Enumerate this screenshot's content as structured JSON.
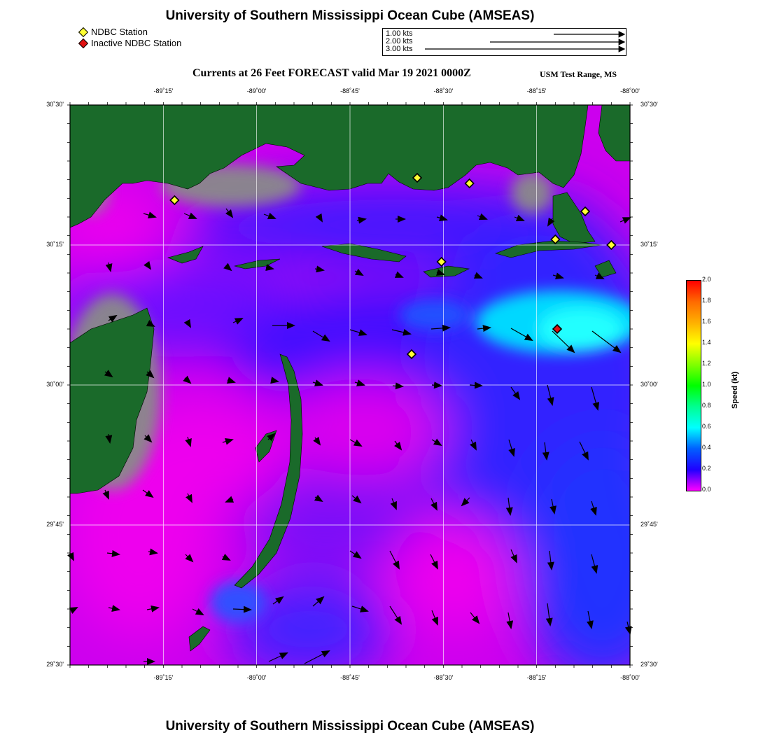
{
  "header": {
    "title": "University of Southern Mississippi Ocean Cube (AMSEAS)",
    "subtitle": "Currents at 26 Feet FORECAST valid Mar 19 2021 0000Z",
    "region": "USM Test Range, MS"
  },
  "footer": {
    "title": "University of Southern Mississippi Ocean Cube (AMSEAS)"
  },
  "legend": {
    "active_label": "NDBC Station",
    "inactive_label": "Inactive NDBC Station",
    "active_color": "#ffff33",
    "inactive_color": "#e01010"
  },
  "scale": {
    "items": [
      "1.00 kts",
      "2.00 kts",
      "3.00 kts"
    ]
  },
  "axes": {
    "x_ticks": [
      "-89˚15'",
      "-89˚00'",
      "-88˚45'",
      "-88˚30'",
      "-88˚15'",
      "-88˚00'"
    ],
    "y_ticks_left": [
      "30˚30'",
      "30˚15'",
      "30˚00'",
      "29˚45'",
      "29˚30'"
    ],
    "y_ticks_right": [
      "30˚30'",
      "30˚15'",
      "30˚00'",
      "29˚45'",
      "29˚30'"
    ]
  },
  "colorbar": {
    "label": "Speed (kt)",
    "ticks": [
      "2.0",
      "1.8",
      "1.6",
      "1.4",
      "1.2",
      "1.0",
      "0.8",
      "0.6",
      "0.4",
      "0.2",
      "0.0"
    ],
    "colors": [
      "#ff0000",
      "#ff6a00",
      "#ffb000",
      "#ffff00",
      "#60ff00",
      "#00ff00",
      "#00ff90",
      "#00ffff",
      "#0060ff",
      "#2000ff",
      "#ff00ff"
    ]
  },
  "colors": {
    "land": "#1a6a2a",
    "shallow": "#888888",
    "water_low": "#ee00ee",
    "water_mid": "#3020ff",
    "water_fast": "#00e0ff"
  },
  "stations": {
    "active": [
      {
        "lon": -89.22,
        "lat": 30.33
      },
      {
        "lon": -88.57,
        "lat": 30.37
      },
      {
        "lon": -88.43,
        "lat": 30.36
      },
      {
        "lon": -88.12,
        "lat": 30.31
      },
      {
        "lon": -88.2,
        "lat": 30.26
      },
      {
        "lon": -88.05,
        "lat": 30.25
      },
      {
        "lon": -88.505,
        "lat": 30.22
      },
      {
        "lon": -88.585,
        "lat": 30.055
      }
    ],
    "inactive": [
      {
        "lon": -88.195,
        "lat": 30.1
      }
    ]
  }
}
